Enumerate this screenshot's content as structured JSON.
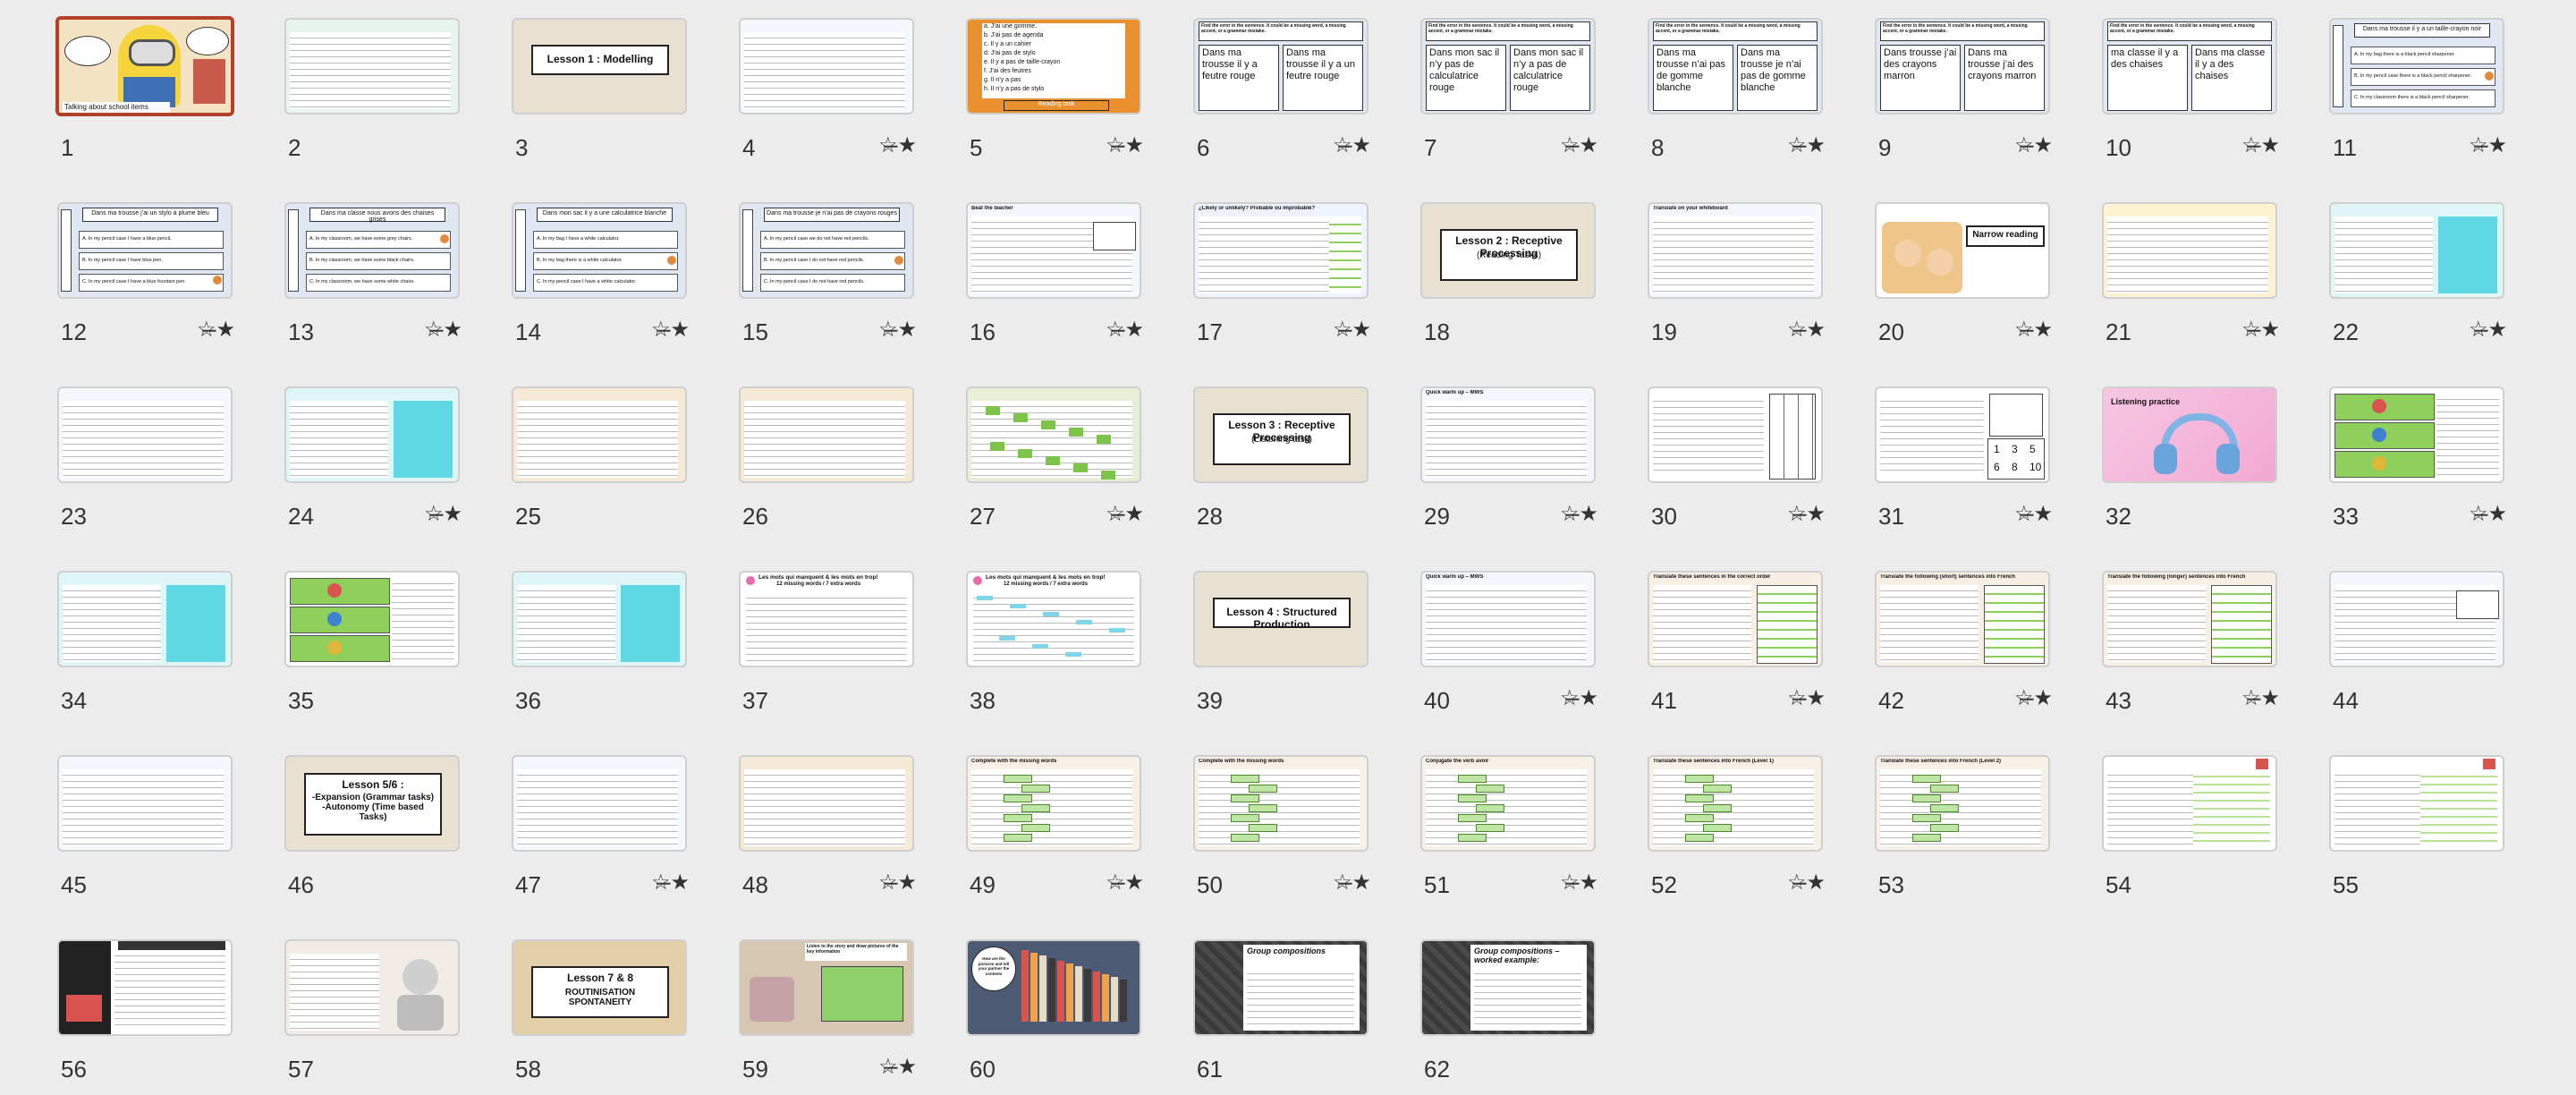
{
  "slides": [
    {
      "n": "1",
      "type": "minion",
      "caption": "Talking about school items",
      "selected": true,
      "starred": false
    },
    {
      "n": "2",
      "type": "grid-colored",
      "starred": false
    },
    {
      "n": "3",
      "type": "title-box",
      "title": "Lesson 1 : Modelling",
      "bg": "#e8e0d0",
      "starred": false
    },
    {
      "n": "4",
      "type": "list",
      "header": "",
      "starred": true
    },
    {
      "n": "5",
      "type": "orange",
      "lines": [
        "a. J’ai une gomme.",
        "b. J’ai pas de agenda",
        "c. Il y a un cahier",
        "d. J’ai pas de stylo",
        "e. Il y a pas de taille-crayon",
        "f. J’ai des feutres",
        "g. Il n’y a pas",
        "h. Il n’y a pas de stylo"
      ],
      "footer": "Reading task",
      "starred": true
    },
    {
      "n": "6",
      "type": "split",
      "header": "Find the error in the sentence. It could be a missing word, a missing accent, or a grammar mistake.",
      "left": "Dans ma trousse il y a feutre rouge",
      "right": "Dans ma trousse il y a un feutre rouge",
      "starred": true
    },
    {
      "n": "7",
      "type": "split",
      "header": "Find the error in the sentence. It could be a missing word, a missing accent, or a grammar mistake.",
      "left": "Dans mon sac il n’y pas de calculatrice rouge",
      "right": "Dans mon sac il n’y a pas de calculatrice rouge",
      "starred": true
    },
    {
      "n": "8",
      "type": "split",
      "header": "Find the error in the sentence. It could be a missing word, a missing accent, or a grammar mistake.",
      "left": "Dans ma trousse n’ai pas de gomme blanche",
      "right": "Dans ma trousse je n’ai pas de gomme blanche",
      "starred": true
    },
    {
      "n": "9",
      "type": "split",
      "header": "Find the error in the sentence. It could be a missing word, a missing accent, or a grammar mistake.",
      "left": "Dans trousse j’ai des crayons marron",
      "right": "Dans ma trousse j’ai des crayons marron",
      "starred": true
    },
    {
      "n": "10",
      "type": "split",
      "header": "Find the error in the sentence. It could be a missing word, a missing accent, or a grammar mistake.",
      "left": "ma classe il y a des chaises",
      "right": "Dans ma classe il y a des chaises",
      "starred": true
    },
    {
      "n": "11",
      "type": "mc",
      "header": "Dans ma trousse il y a un taille-crayon noir",
      "opts": [
        "A. In my bag there is a black pencil sharpener.",
        "B. In my pencil case there is a black pencil sharpener.",
        "C. In my classroom there is a black pencil sharpener."
      ],
      "starred": true
    },
    {
      "n": "12",
      "type": "mc",
      "header": "Dans ma trousse j’ai un stylo à plume bleu",
      "opts": [
        "A. In my pencil case I have a blue pencil.",
        "B. In my pencil case I have blue pen.",
        "C. In my pencil case I have a blue fountain pen."
      ],
      "starred": true
    },
    {
      "n": "13",
      "type": "mc",
      "header": "Dans ma classe nous avons des chaises grises",
      "opts": [
        "A. In my classroom, we have some grey chairs.",
        "B. In my classroom, we have some black chairs.",
        "C. In my classroom, we have some white chairs."
      ],
      "starred": true
    },
    {
      "n": "14",
      "type": "mc",
      "header": "Dans mon sac il y a une calculatrice blanche",
      "opts": [
        "A. In my bag I have a white calculator.",
        "B. In my bag there is a white calculator.",
        "C. In my pencil case I have a white calculator."
      ],
      "starred": true
    },
    {
      "n": "15",
      "type": "mc",
      "header": "Dans ma trousse je n’ai pas de crayons rouges",
      "opts": [
        "A. In my pencil case we do not have red pencils.",
        "B. In my pencil case I do not have red pencils.",
        "C. In my pencil case I do not have red pencils."
      ],
      "starred": true
    },
    {
      "n": "16",
      "type": "table",
      "header": "Beat the teacher",
      "starred": true
    },
    {
      "n": "17",
      "type": "lines-right",
      "header": "¿Likely or unlikely? Probable ou improbable?",
      "starred": true
    },
    {
      "n": "18",
      "type": "title-box",
      "title": "Lesson 2 : Receptive Processing",
      "sub": "(Reading Tasks)",
      "bg": "#e8e0d0",
      "starred": false
    },
    {
      "n": "19",
      "type": "list",
      "header": "Translate on your whiteboard",
      "starred": true
    },
    {
      "n": "20",
      "type": "narrow",
      "title": "Narrow reading",
      "starred": true
    },
    {
      "n": "21",
      "type": "dense-yellow",
      "starred": true
    },
    {
      "n": "22",
      "type": "dense-cyan",
      "starred": true
    },
    {
      "n": "23",
      "type": "dense",
      "starred": false
    },
    {
      "n": "24",
      "type": "dense-cyan",
      "starred": true
    },
    {
      "n": "25",
      "type": "dense-multi",
      "starred": false
    },
    {
      "n": "26",
      "type": "dense-multi",
      "starred": false
    },
    {
      "n": "27",
      "type": "dense-green",
      "starred": true
    },
    {
      "n": "28",
      "type": "title-box",
      "title": "Lesson 3 : Receptive Processing",
      "sub": "(Listening task)",
      "bg": "#e8e0d0",
      "starred": false
    },
    {
      "n": "29",
      "type": "list",
      "header": "Quick warm up – MWS",
      "starred": true
    },
    {
      "n": "30",
      "type": "list-grid",
      "starred": true
    },
    {
      "n": "31",
      "type": "list-nums",
      "nums": [
        "1",
        "3",
        "5",
        "6",
        "8",
        "10"
      ],
      "starred": true
    },
    {
      "n": "32",
      "type": "headphones",
      "caption": "Listening practice",
      "starred": false
    },
    {
      "n": "33",
      "type": "green-speakers",
      "starred": true
    },
    {
      "n": "34",
      "type": "dense-cyan",
      "starred": false
    },
    {
      "n": "35",
      "type": "green-speakers",
      "starred": false
    },
    {
      "n": "36",
      "type": "dense-cyan",
      "starred": false
    },
    {
      "n": "37",
      "type": "text-passage",
      "header": "Les mots qui manquent & les mots en trop!",
      "sub": "12 missing words / 7 extra words",
      "starred": false
    },
    {
      "n": "38",
      "type": "text-passage",
      "header": "Les mots qui manquent & les mots en trop!",
      "sub": "12 missing words / 7 extra words",
      "starred": false
    },
    {
      "n": "39",
      "type": "title-box",
      "title": "Lesson 4 : Structured Production",
      "bg": "#e8e0d0",
      "starred": false
    },
    {
      "n": "40",
      "type": "list",
      "header": "Quick warm up – MWS",
      "starred": true
    },
    {
      "n": "41",
      "type": "two-col-green",
      "header": "Translate these sentences in the correct order",
      "starred": true
    },
    {
      "n": "42",
      "type": "two-col-green",
      "header": "Translate the following (short) sentences into French",
      "starred": true
    },
    {
      "n": "43",
      "type": "two-col-green",
      "header": "Translate the following (longer) sentences into French",
      "starred": true
    },
    {
      "n": "44",
      "type": "table",
      "header": "",
      "starred": false
    },
    {
      "n": "45",
      "type": "dense",
      "starred": false
    },
    {
      "n": "46",
      "type": "title-box",
      "title": "Lesson 5/6 :",
      "sub": "-Expansion (Grammar tasks) -Autonomy (Time based Tasks)",
      "bg": "#e8e0d0",
      "starred": false
    },
    {
      "n": "47",
      "type": "list",
      "header": "",
      "starred": true
    },
    {
      "n": "48",
      "type": "dense-multi",
      "starred": true
    },
    {
      "n": "49",
      "type": "fill-green",
      "header": "Complete with the missing words",
      "starred": true
    },
    {
      "n": "50",
      "type": "fill-green",
      "header": "Complete with the missing words",
      "starred": true
    },
    {
      "n": "51",
      "type": "fill-green",
      "header": "Conjugate the verb avoir",
      "starred": true
    },
    {
      "n": "52",
      "type": "fill-green",
      "header": "Translate these sentences into French (Level 1)",
      "starred": true
    },
    {
      "n": "53",
      "type": "fill-green",
      "header": "Translate these sentences into French (Level 2)",
      "starred": false
    },
    {
      "n": "54",
      "type": "table-green",
      "starred": false
    },
    {
      "n": "55",
      "type": "table-green",
      "starred": false
    },
    {
      "n": "56",
      "type": "dark-list",
      "starred": false
    },
    {
      "n": "57",
      "type": "robot",
      "starred": false
    },
    {
      "n": "58",
      "type": "title-box",
      "title": "Lesson 7 & 8",
      "sub": "ROUTINISATION SPONTANEITY",
      "bg": "#e2cfa8",
      "starred": false
    },
    {
      "n": "59",
      "type": "bag",
      "caption": "Listen to the story and draw pictures of the key information",
      "starred": true
    },
    {
      "n": "60",
      "type": "books",
      "caption": "How are the pictures and tell your partner the contents",
      "starred": false
    },
    {
      "n": "61",
      "type": "dark-comp",
      "title": "Group compositions",
      "starred": false
    },
    {
      "n": "62",
      "type": "dark-comp",
      "title": "Group compositions – worked example:",
      "starred": false
    }
  ],
  "star_glyph": "☆̶★",
  "colors": {
    "selected_border": "#b5402a",
    "background": "#ececec"
  }
}
